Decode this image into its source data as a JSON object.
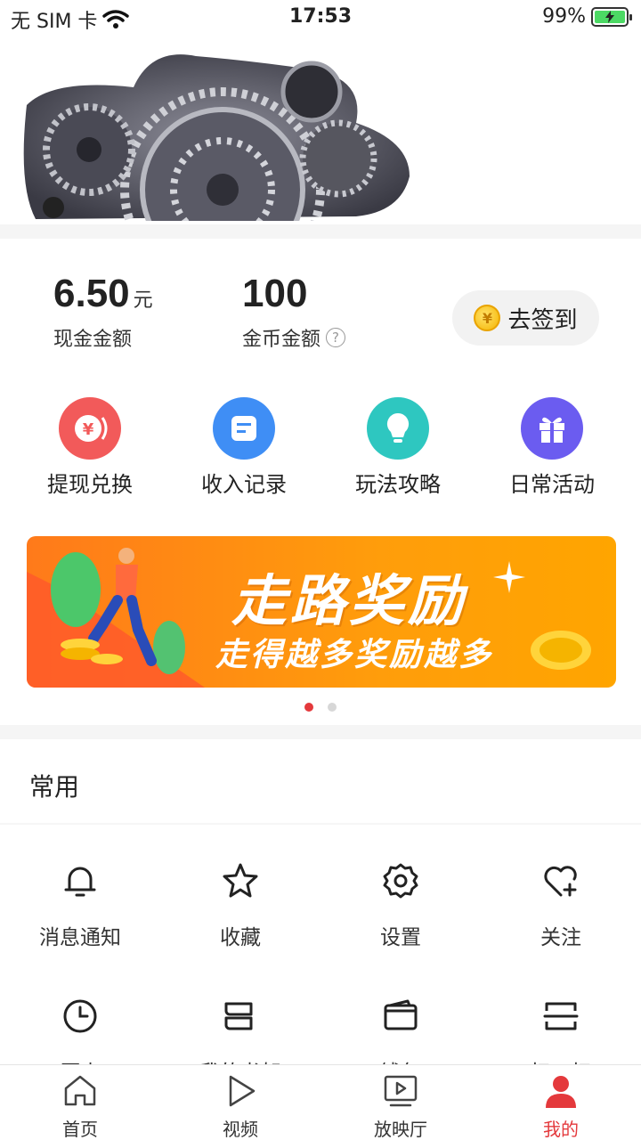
{
  "status_bar": {
    "carrier": "无 SIM 卡",
    "time": "17:53",
    "battery": "99%"
  },
  "balances": {
    "cash": {
      "value": "6.50",
      "unit": "元",
      "label": "现金金额"
    },
    "coins": {
      "value": "100",
      "label": "金币金额",
      "help": "?"
    }
  },
  "signin": {
    "label": "去签到",
    "coin_symbol": "¥"
  },
  "quick_actions": [
    {
      "label": "提现兑换",
      "color": "#f25a5a",
      "icon": "yen-coin-icon"
    },
    {
      "label": "收入记录",
      "color": "#3f8ef5",
      "icon": "record-icon"
    },
    {
      "label": "玩法攻略",
      "color": "#2ec7c0",
      "icon": "lightbulb-icon"
    },
    {
      "label": "日常活动",
      "color": "#6b5cf0",
      "icon": "gift-icon"
    }
  ],
  "banner": {
    "title": "走路奖励",
    "subtitle": "走得越多奖励越多",
    "dots": 2,
    "active_dot": 0
  },
  "common": {
    "title": "常用",
    "items": [
      {
        "label": "消息通知",
        "icon": "bell-icon"
      },
      {
        "label": "收藏",
        "icon": "star-icon"
      },
      {
        "label": "设置",
        "icon": "gear-icon"
      },
      {
        "label": "关注",
        "icon": "heart-plus-icon"
      },
      {
        "label": "历史",
        "icon": "clock-icon"
      },
      {
        "label": "我的书架",
        "icon": "bookshelf-icon"
      },
      {
        "label": "钱包",
        "icon": "wallet-icon"
      },
      {
        "label": "扫一扫",
        "icon": "scan-icon"
      }
    ]
  },
  "tabbar": {
    "active": "我的",
    "tabs": [
      {
        "label": "首页",
        "icon": "home-icon"
      },
      {
        "label": "视频",
        "icon": "play-icon"
      },
      {
        "label": "放映厅",
        "icon": "screen-icon"
      },
      {
        "label": "我的",
        "icon": "person-icon"
      }
    ]
  },
  "colors": {
    "accent": "#e4393c",
    "banner": "#ff9d0b"
  }
}
